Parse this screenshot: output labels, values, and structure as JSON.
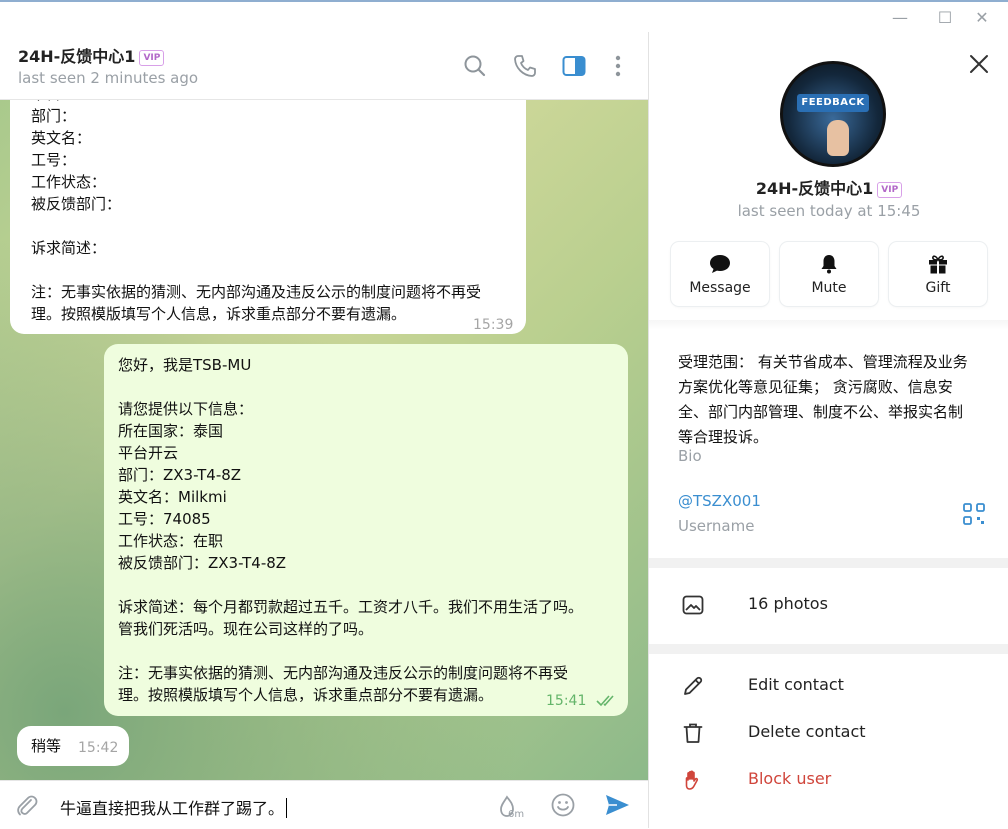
{
  "window": {
    "minimize": "—",
    "maximize": "☐",
    "close": "✕"
  },
  "chat": {
    "name": "24H-反馈中心1",
    "vip_badge": "VIP",
    "status": "last seen 2 minutes ago",
    "messages": [
      {
        "direction": "incoming",
        "lines": [
          "平台",
          "部门：",
          "英文名：",
          "工号：",
          "工作状态：",
          "被反馈部门：",
          "",
          "诉求简述：",
          "",
          "注：无事实依据的猜测、无内部沟通及违反公示的制度问题将不再受",
          "理。按照模版填写个人信息，诉求重点部分不要有遗漏。"
        ],
        "time": "15:39"
      },
      {
        "direction": "outgoing",
        "lines": [
          "您好，我是TSB-MU",
          "",
          "请您提供以下信息：",
          "所在国家：泰国",
          "平台开云",
          "部门：ZX3-T4-8Z",
          "英文名：Milkmi",
          "工号：74085",
          "工作状态：在职",
          "被反馈部门：ZX3-T4-8Z",
          "",
          "诉求简述：每个月都罚款超过五千。工资才八千。我们不用生活了吗。",
          "管我们死活吗。现在公司这样的了吗。",
          "",
          "注：无事实依据的猜测、无内部沟通及违反公示的制度问题将不再受",
          "理。按照模版填写个人信息，诉求重点部分不要有遗漏。"
        ],
        "time": "15:41",
        "read": true
      },
      {
        "direction": "incoming",
        "lines": [
          "稍等"
        ],
        "time": "15:42"
      }
    ],
    "composer": {
      "text": "牛逼直接把我从工作群了踢了。",
      "timer_label": "6m"
    }
  },
  "profile": {
    "avatar_text": "FEEDBACK",
    "name": "24H-反馈中心1",
    "vip_badge": "VIP",
    "status": "last seen today at 15:45",
    "actions": [
      {
        "label": "Message",
        "icon": "message-icon"
      },
      {
        "label": "Mute",
        "icon": "bell-icon"
      },
      {
        "label": "Gift",
        "icon": "gift-icon"
      }
    ],
    "bio_lines": [
      "受理范围： 有关节省成本、管理流程及业务",
      "方案优化等意见征集； 贪污腐败、信息安",
      "全、部门内部管理、制度不公、举报实名制",
      "等合理投诉。"
    ],
    "bio_label": "Bio",
    "username": "@TSZX001",
    "username_label": "Username",
    "photos": "16 photos",
    "edit_contact": "Edit contact",
    "delete_contact": "Delete contact",
    "block_user": "Block user"
  },
  "colors": {
    "accent": "#3a8ed0",
    "outgoing_bubble": "#effdde",
    "danger": "#d0453b",
    "read_check": "#64b56a"
  }
}
